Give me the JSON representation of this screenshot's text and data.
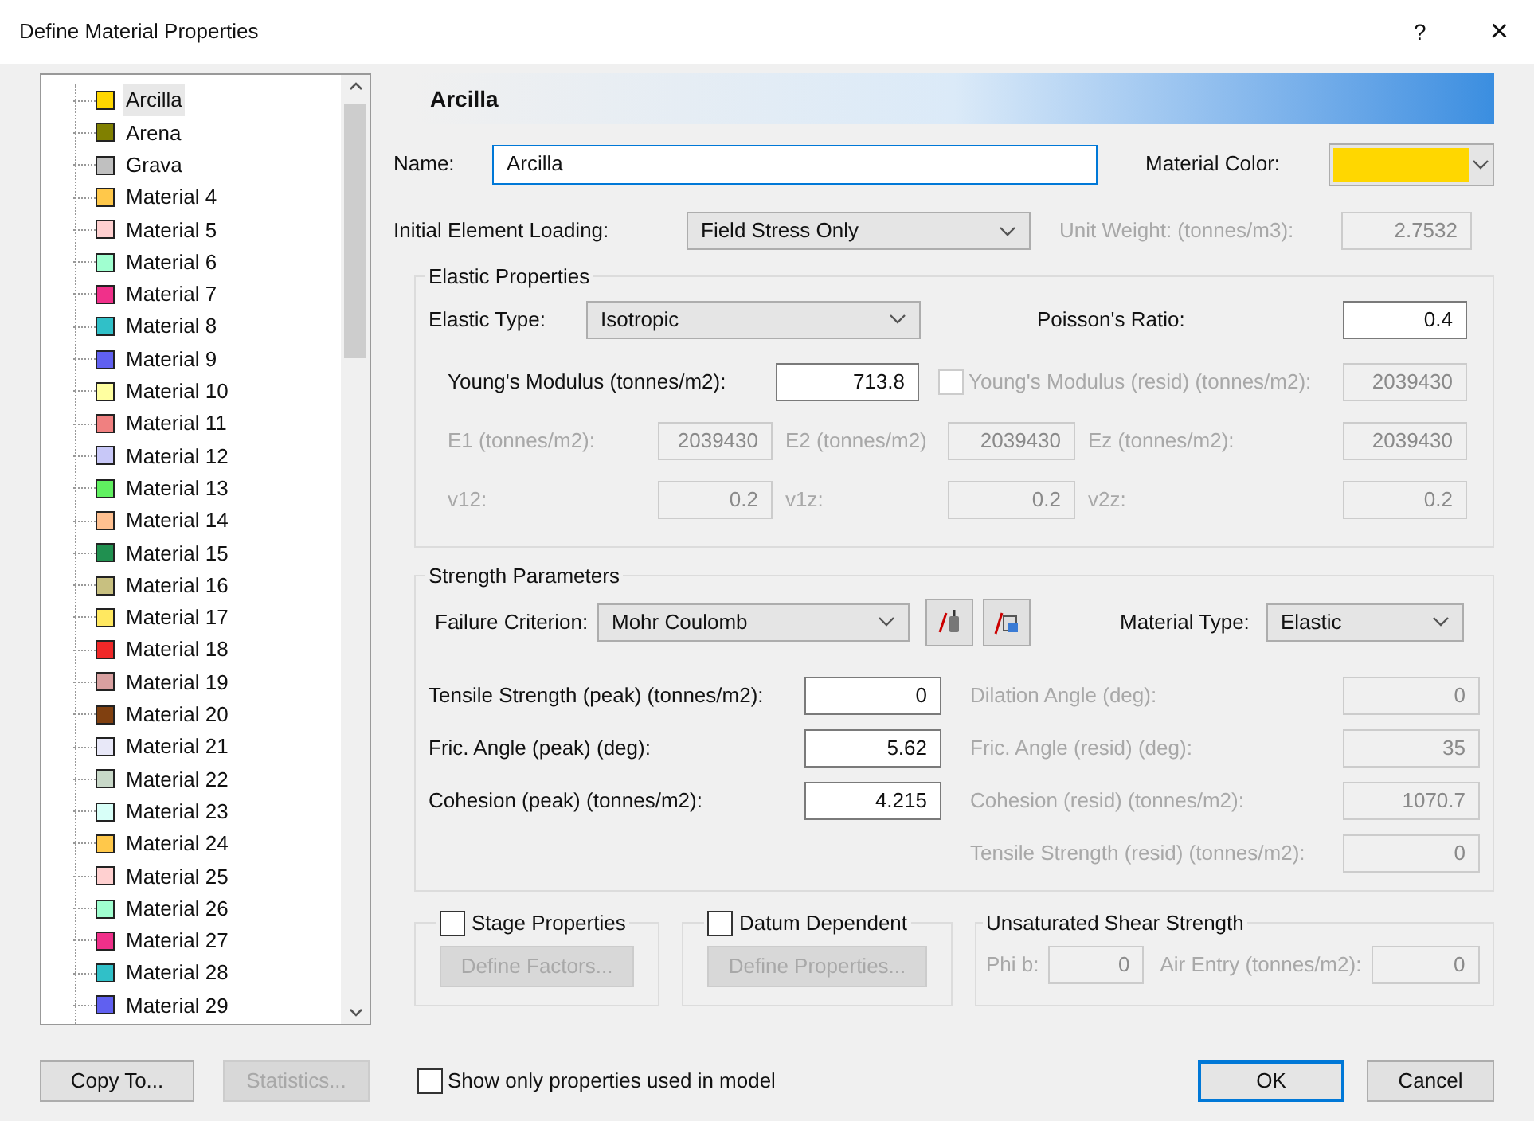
{
  "window": {
    "title": "Define Material Properties",
    "help": "?",
    "close": "×"
  },
  "materials": [
    {
      "name": "Arcilla",
      "color": "#ffd700",
      "selected": true
    },
    {
      "name": "Arena",
      "color": "#808000",
      "selected": false
    },
    {
      "name": "Grava",
      "color": "#c0c0c0",
      "selected": false
    },
    {
      "name": "Material 4",
      "color": "#ffc84a",
      "selected": false
    },
    {
      "name": "Material 5",
      "color": "#ffd0d0",
      "selected": false
    },
    {
      "name": "Material 6",
      "color": "#a0ffd0",
      "selected": false
    },
    {
      "name": "Material 7",
      "color": "#f0308a",
      "selected": false
    },
    {
      "name": "Material 8",
      "color": "#30c0c8",
      "selected": false
    },
    {
      "name": "Material 9",
      "color": "#6060f0",
      "selected": false
    },
    {
      "name": "Material 10",
      "color": "#ffffa0",
      "selected": false
    },
    {
      "name": "Material 11",
      "color": "#f08080",
      "selected": false
    },
    {
      "name": "Material 12",
      "color": "#c8c8f8",
      "selected": false
    },
    {
      "name": "Material 13",
      "color": "#60f060",
      "selected": false
    },
    {
      "name": "Material 14",
      "color": "#ffc090",
      "selected": false
    },
    {
      "name": "Material 15",
      "color": "#209050",
      "selected": false
    },
    {
      "name": "Material 16",
      "color": "#c8c080",
      "selected": false
    },
    {
      "name": "Material 17",
      "color": "#ffe860",
      "selected": false
    },
    {
      "name": "Material 18",
      "color": "#f02828",
      "selected": false
    },
    {
      "name": "Material 19",
      "color": "#d8a0a0",
      "selected": false
    },
    {
      "name": "Material 20",
      "color": "#804010",
      "selected": false
    },
    {
      "name": "Material 21",
      "color": "#e8e8f8",
      "selected": false
    },
    {
      "name": "Material 22",
      "color": "#c8d8c8",
      "selected": false
    },
    {
      "name": "Material 23",
      "color": "#d8fff8",
      "selected": false
    },
    {
      "name": "Material 24",
      "color": "#ffc84a",
      "selected": false
    },
    {
      "name": "Material 25",
      "color": "#ffd0d0",
      "selected": false
    },
    {
      "name": "Material 26",
      "color": "#a0ffd0",
      "selected": false
    },
    {
      "name": "Material 27",
      "color": "#f0308a",
      "selected": false
    },
    {
      "name": "Material 28",
      "color": "#30c0c8",
      "selected": false
    },
    {
      "name": "Material 29",
      "color": "#6060f0",
      "selected": false
    }
  ],
  "header_title": "Arcilla",
  "name_field": {
    "label": "Name:",
    "value": "Arcilla"
  },
  "material_color": {
    "label": "Material Color:",
    "color": "#ffd700"
  },
  "initial_loading": {
    "label": "Initial Element Loading:",
    "value": "Field Stress Only"
  },
  "unit_weight": {
    "label": "Unit Weight: (tonnes/m3):",
    "value": "2.7532",
    "disabled": true
  },
  "elastic": {
    "title": "Elastic Properties",
    "type": {
      "label": "Elastic Type:",
      "value": "Isotropic"
    },
    "poisson": {
      "label": "Poisson's Ratio:",
      "value": "0.4",
      "disabled": false
    },
    "young": {
      "label": "Young's Modulus (tonnes/m2):",
      "value": "713.8",
      "disabled": false
    },
    "young_resid": {
      "label": "Young's Modulus (resid) (tonnes/m2):",
      "value": "2039430",
      "checked": false,
      "disabled": true
    },
    "grid": [
      {
        "label": "E1 (tonnes/m2):",
        "value": "2039430",
        "disabled": true
      },
      {
        "label": "E2 (tonnes/m2)",
        "value": "2039430",
        "disabled": true
      },
      {
        "label": "Ez (tonnes/m2):",
        "value": "2039430",
        "disabled": true
      },
      {
        "label": "v12:",
        "value": "0.2",
        "disabled": true
      },
      {
        "label": "v1z:",
        "value": "0.2",
        "disabled": true
      },
      {
        "label": "v2z:",
        "value": "0.2",
        "disabled": true
      }
    ]
  },
  "strength": {
    "title": "Strength Parameters",
    "criterion": {
      "label": "Failure Criterion:",
      "value": "Mohr Coulomb"
    },
    "material_type": {
      "label": "Material Type:",
      "value": "Elastic"
    },
    "peak": [
      {
        "label": "Tensile Strength (peak) (tonnes/m2):",
        "value": "0",
        "disabled": false
      },
      {
        "label": "Fric. Angle (peak) (deg):",
        "value": "5.62",
        "disabled": false
      },
      {
        "label": "Cohesion (peak) (tonnes/m2):",
        "value": "4.215",
        "disabled": false
      }
    ],
    "resid": [
      {
        "label": "Dilation Angle (deg):",
        "value": "0",
        "disabled": true
      },
      {
        "label": "Fric. Angle (resid) (deg):",
        "value": "35",
        "disabled": true
      },
      {
        "label": "Cohesion (resid) (tonnes/m2):",
        "value": "1070.7",
        "disabled": true
      },
      {
        "label": "Tensile Strength (resid) (tonnes/m2):",
        "value": "0",
        "disabled": true
      }
    ]
  },
  "stage": {
    "label": "Stage Properties",
    "checked": false,
    "button": "Define Factors...",
    "disabled": true
  },
  "datum": {
    "label": "Datum Dependent",
    "checked": false,
    "button": "Define Properties...",
    "disabled": true
  },
  "unsaturated": {
    "title": "Unsaturated Shear Strength",
    "phi": {
      "label": "Phi b:",
      "value": "0",
      "disabled": true
    },
    "air": {
      "label": "Air Entry (tonnes/m2):",
      "value": "0",
      "disabled": true
    }
  },
  "footer": {
    "copy_to": {
      "label": "Copy To...",
      "disabled": false
    },
    "statistics": {
      "label": "Statistics...",
      "disabled": true
    },
    "show_only": {
      "label": "Show only properties used in model",
      "checked": false
    },
    "ok": "OK",
    "cancel": "Cancel"
  }
}
